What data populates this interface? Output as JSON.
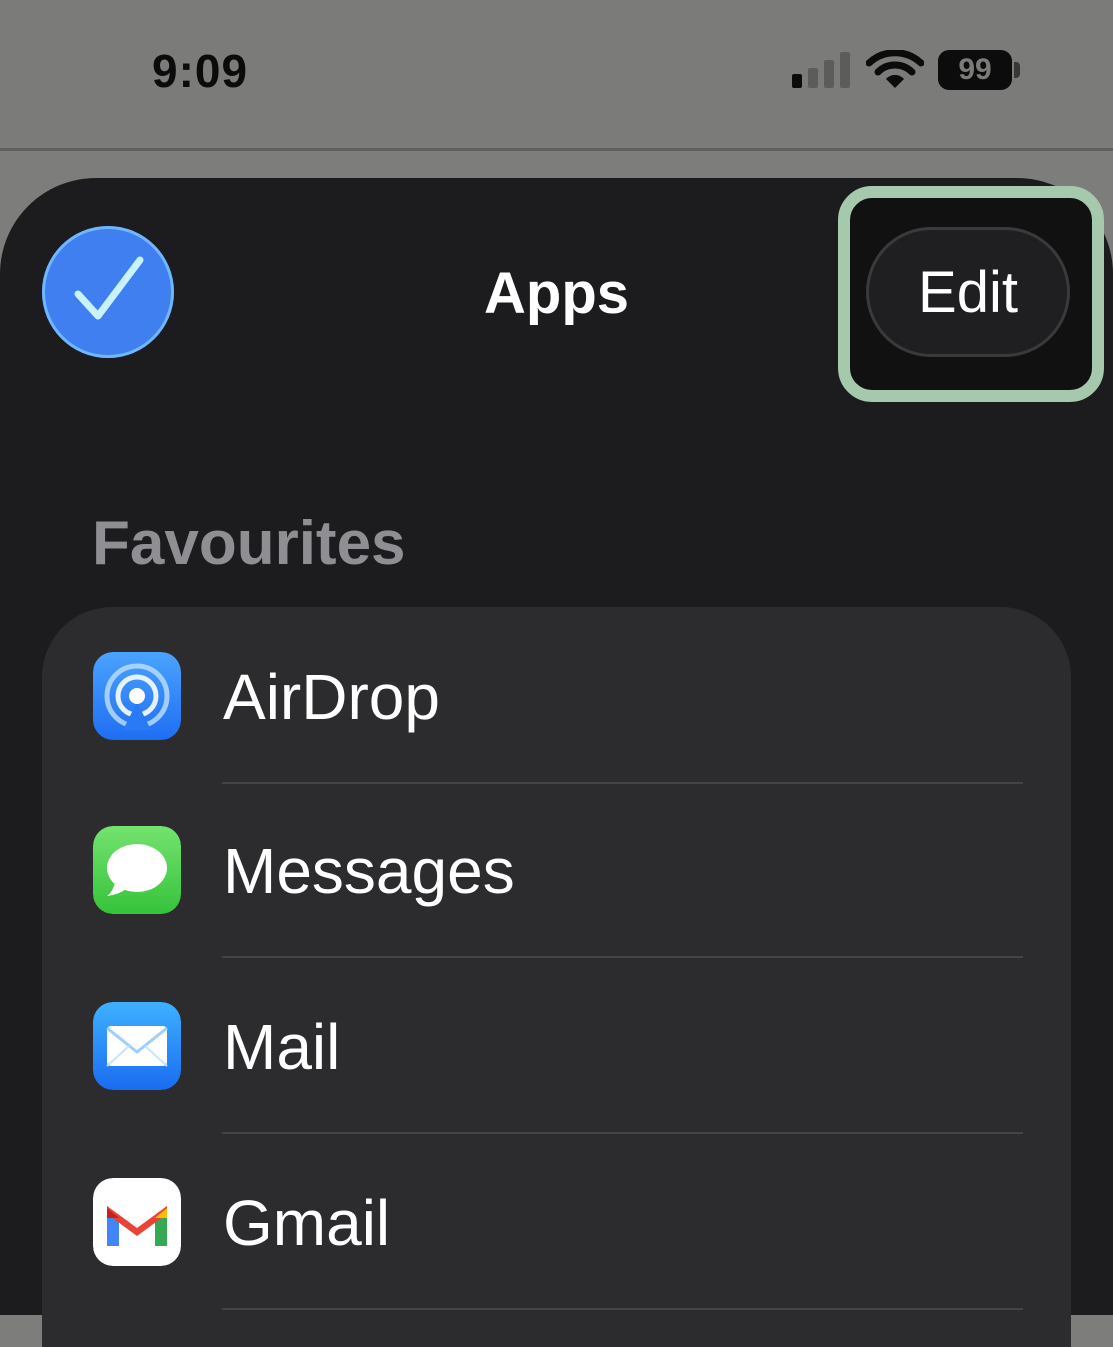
{
  "status_bar": {
    "time": "9:09",
    "battery_level": "99",
    "signal_bars": 1,
    "signal_bars_total": 4
  },
  "sheet": {
    "title": "Apps",
    "done_icon": "checkmark-icon",
    "edit_label": "Edit",
    "highlight_color": "#a6c8ad"
  },
  "favourites": {
    "header": "Favourites",
    "items": [
      {
        "label": "AirDrop",
        "icon": "airdrop-icon"
      },
      {
        "label": "Messages",
        "icon": "messages-icon"
      },
      {
        "label": "Mail",
        "icon": "mail-icon"
      },
      {
        "label": "Gmail",
        "icon": "gmail-icon"
      }
    ]
  },
  "colors": {
    "accent": "#3f7ff0",
    "sheet_bg": "#1c1c1e",
    "list_bg": "#2c2c2e",
    "secondary_text": "#8e8e93"
  }
}
